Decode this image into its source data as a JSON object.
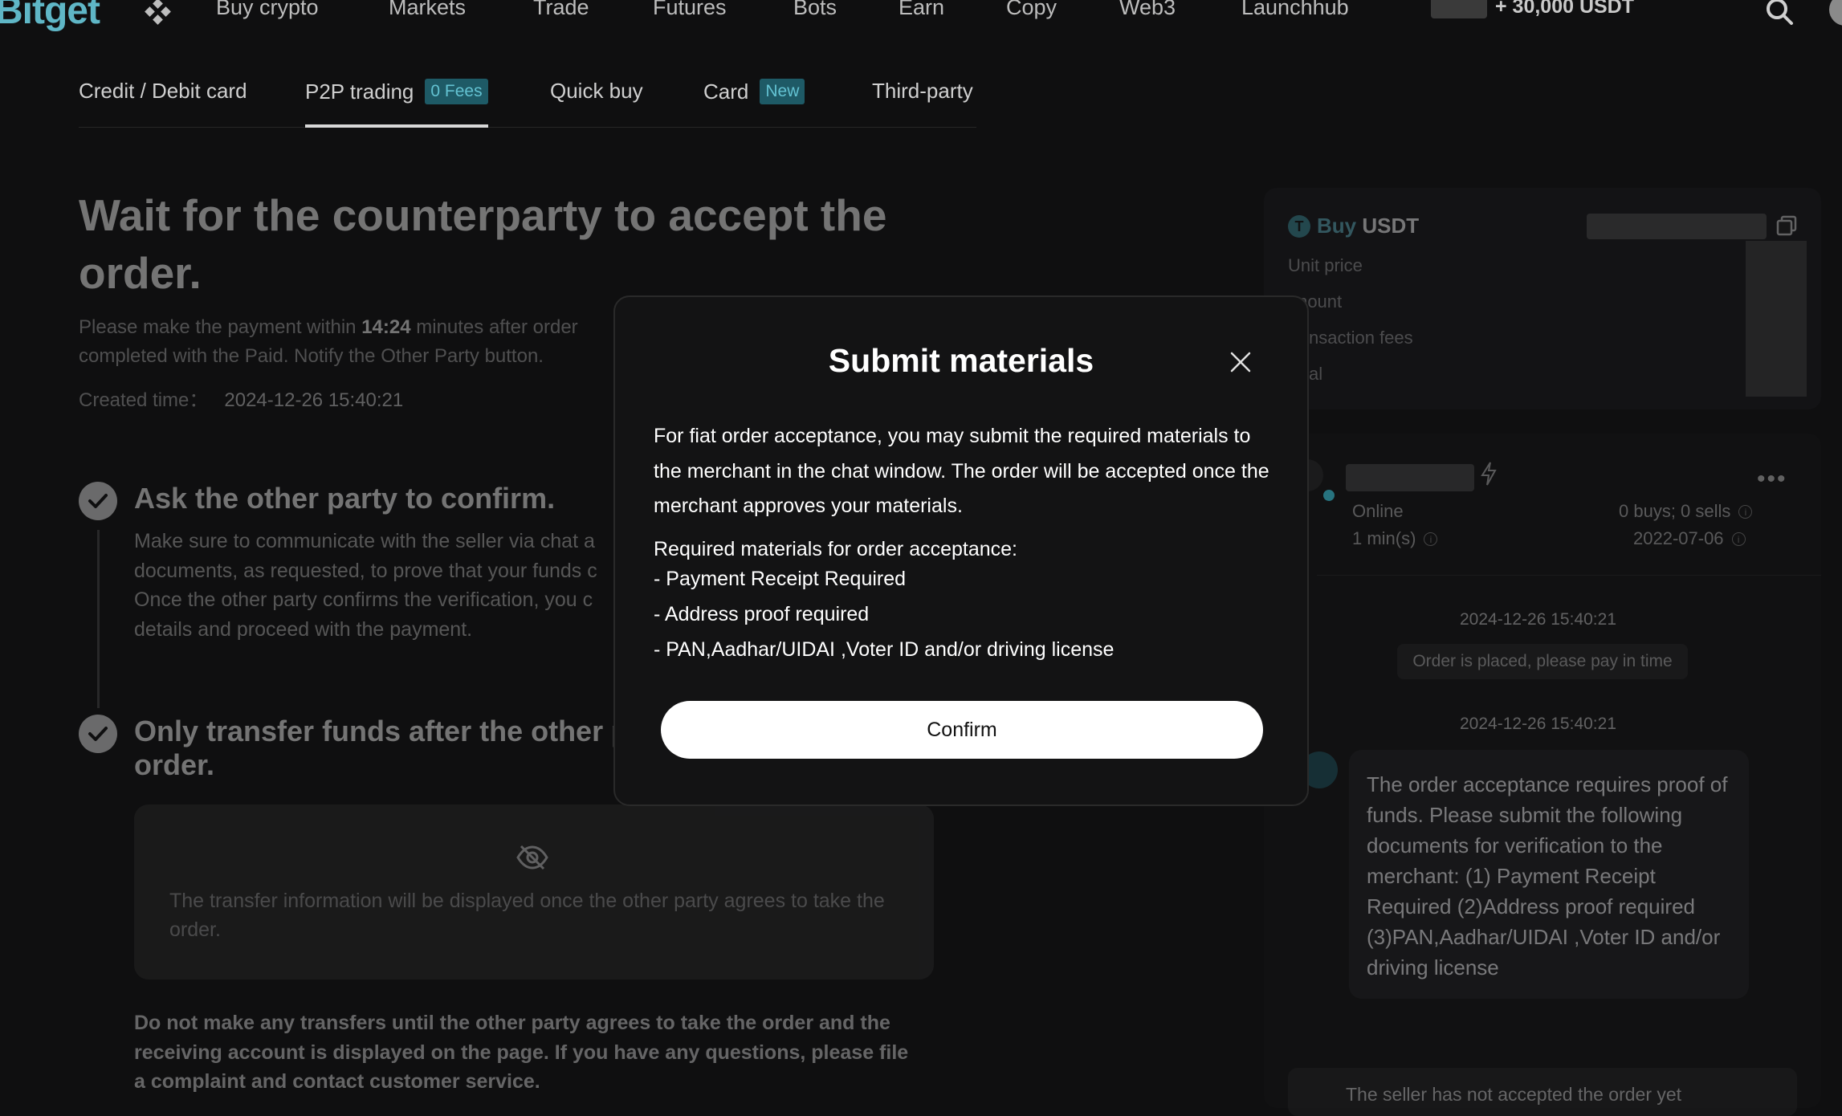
{
  "app": {
    "logo": "Bitget"
  },
  "nav": {
    "items": [
      "Buy crypto",
      "Markets",
      "Trade",
      "Futures",
      "Bots",
      "Earn",
      "Copy",
      "Web3",
      "Launchhub"
    ],
    "promo": "+ 30,000 USDT",
    "icons": [
      "grid-icon",
      "search-icon"
    ]
  },
  "tabs": [
    {
      "label": "Credit / Debit card",
      "badge": ""
    },
    {
      "label": "P2P trading",
      "badge": "0 Fees",
      "active": true
    },
    {
      "label": "Quick buy",
      "badge": ""
    },
    {
      "label": "Card",
      "badge": "New"
    },
    {
      "label": "Third-party",
      "badge": ""
    }
  ],
  "order": {
    "title": "Wait for the counterparty to accept the order.",
    "pay_prefix": "Please make the payment within ",
    "pay_time": "14:24",
    "pay_suffix": " minutes after order completed with the Paid. Notify the Other Party button.",
    "created_label": "Created time：",
    "created_value": "2024-12-26 15:40:21"
  },
  "steps": [
    {
      "title": "Ask the other party to confirm.",
      "text": "Make sure to communicate with the seller via chat a documents, as requested, to prove that your funds c Once the other party confirms the verification, you c details and proceed with the payment."
    },
    {
      "title": "Only transfer funds after the other p order."
    }
  ],
  "transfer_info": {
    "icon": "eye-off-icon",
    "text": "The transfer information will be displayed once the other party agrees to take the order."
  },
  "warning": "Do not make any transfers until the other party agrees to take the order and the receiving account is displayed on the page. If you have any questions, please file a complaint and contact customer service.",
  "order_card": {
    "buy": "Buy",
    "asset": "USDT",
    "labels": [
      "Unit price",
      "mount",
      "nsaction fees",
      "al"
    ]
  },
  "merchant": {
    "status": "Online",
    "stats": "0 buys; 0 sells",
    "response": "1 min(s)",
    "joined": "2022-07-06"
  },
  "chat": {
    "time1": "2024-12-26 15:40:21",
    "system_msg": "Order is placed, please pay in time",
    "time2": "2024-12-26 15:40:21",
    "message": "The order acceptance requires proof of funds. Please submit the following documents for verification to the merchant: (1) Payment Receipt Required (2)Address proof required (3)PAN,Aadhar/UIDAI ,Voter ID and/or driving license",
    "bottom": "The seller has not accepted the order yet"
  },
  "modal": {
    "title": "Submit materials",
    "body": "For fiat order acceptance, you may submit the required materials to the merchant in the chat window. The order will be accepted once the merchant approves your materials.",
    "required_title": "Required materials for order acceptance:",
    "required_items": [
      "- Payment Receipt Required",
      "- Address proof required",
      "- PAN,Aadhar/UIDAI ,Voter ID and/or driving license"
    ],
    "confirm_label": "Confirm"
  },
  "colors": {
    "background": "#0f0f10",
    "accent": "#5fb6c6",
    "badge_bg": "#1e5a66",
    "modal_bg": "#131314",
    "button_bg": "#ffffff"
  }
}
